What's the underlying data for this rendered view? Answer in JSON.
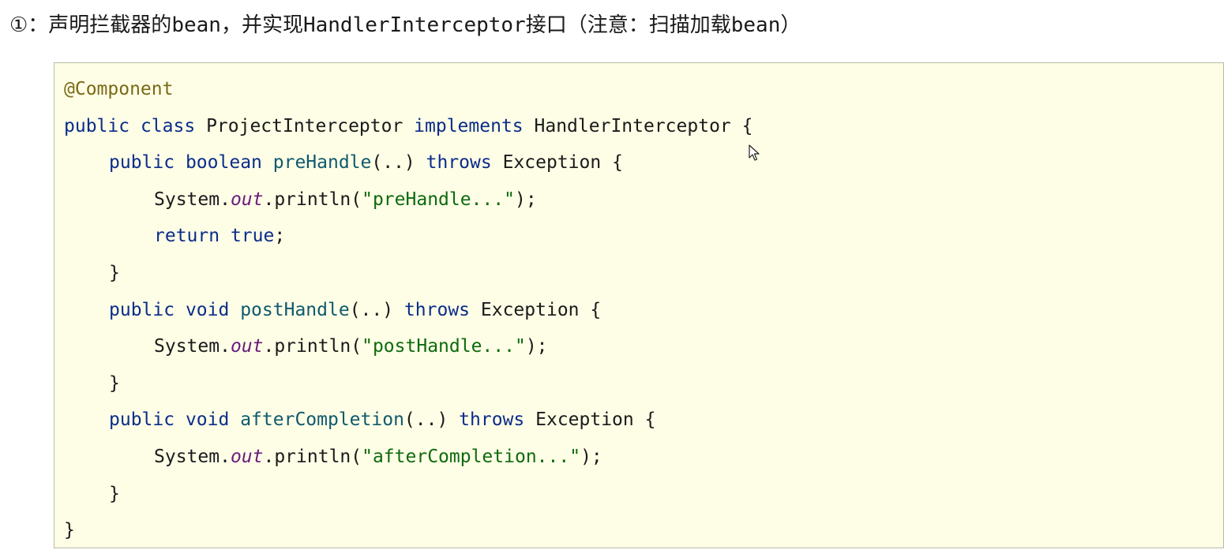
{
  "heading": {
    "prefix": "①：声明拦截器的",
    "bean1": "bean",
    "middle": "，并实现",
    "iface": "HandlerInterceptor",
    "suffix1": "接口（注意：扫描加载",
    "bean2": "bean",
    "suffix2": "）"
  },
  "code": {
    "l1": {
      "annotation": "@Component"
    },
    "l2": {
      "kw1": "public",
      "kw2": "class",
      "name": "ProjectInterceptor",
      "kw3": "implements",
      "iface": "HandlerInterceptor",
      "brace": "{"
    },
    "l3": {
      "kw1": "public",
      "kw2": "boolean",
      "method": "preHandle",
      "args": "(..)",
      "kw3": "throws",
      "exc": "Exception",
      "brace": "{"
    },
    "l4": {
      "cls": "System.",
      "field": "out",
      "call": ".println(",
      "str": "\"preHandle...\"",
      "end": ");"
    },
    "l5": {
      "kw1": "return",
      "kw2": "true",
      "end": ";"
    },
    "l6": {
      "brace": "}"
    },
    "l7": {
      "kw1": "public",
      "kw2": "void",
      "method": "postHandle",
      "args": "(..)",
      "kw3": "throws",
      "exc": "Exception",
      "brace": "{"
    },
    "l8": {
      "cls": "System.",
      "field": "out",
      "call": ".println(",
      "str": "\"postHandle...\"",
      "end": ");"
    },
    "l9": {
      "brace": "}"
    },
    "l10": {
      "kw1": "public",
      "kw2": "void",
      "method": "afterCompletion",
      "args": "(..)",
      "kw3": "throws",
      "exc": "Exception",
      "brace": "{"
    },
    "l11": {
      "cls": "System.",
      "field": "out",
      "call": ".println(",
      "str": "\"afterCompletion...\"",
      "end": ");"
    },
    "l12": {
      "brace": "}"
    },
    "l13": {
      "brace": "}"
    }
  },
  "colors": {
    "code_background": "#fefde6",
    "annotation": "#7a6a16",
    "keyword": "#0a2d8a",
    "method": "#0e5a6e",
    "string": "#0d6a0d",
    "field": "#6a1a7a"
  },
  "icons": {
    "cursor": "mouse-pointer-icon"
  }
}
